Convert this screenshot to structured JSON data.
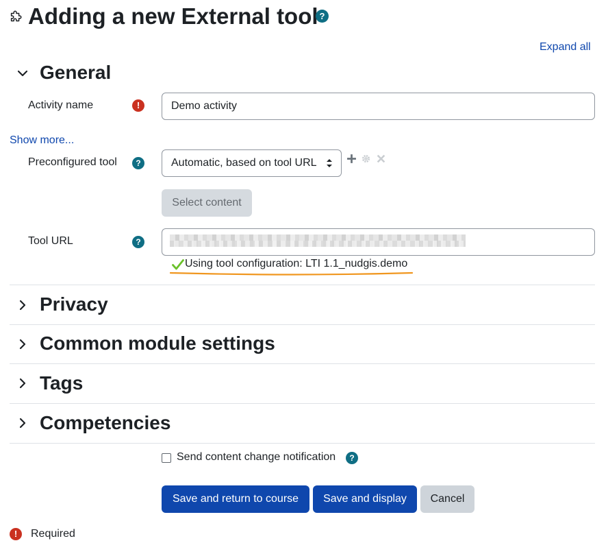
{
  "page": {
    "title": "Adding a new External tool",
    "title_icon": "puzzle-icon",
    "expand_all_label": "Expand all"
  },
  "general": {
    "title": "General",
    "activity_name": {
      "label": "Activity name",
      "value": "Demo activity"
    },
    "show_more_label": "Show more...",
    "preconfigured_tool": {
      "label": "Preconfigured tool",
      "selected": "Automatic, based on tool URL"
    },
    "select_content_label": "Select content",
    "tool_url": {
      "label": "Tool URL",
      "config_message": "Using tool configuration: LTI 1.1_nudgis.demo"
    }
  },
  "sections": [
    {
      "title": "Privacy"
    },
    {
      "title": "Common module settings"
    },
    {
      "title": "Tags"
    },
    {
      "title": "Competencies"
    }
  ],
  "notification_label": "Send content change notification",
  "buttons": {
    "save_return": "Save and return to course",
    "save_display": "Save and display",
    "cancel": "Cancel"
  },
  "required_label": "Required",
  "icon_glyphs": {
    "help": "?",
    "required": "!"
  },
  "colors": {
    "primary": "#0f47ad",
    "help": "#0f6e84",
    "required": "#ca3120",
    "highlight_underline": "#f0961e",
    "success_check": "#6ac12a"
  }
}
